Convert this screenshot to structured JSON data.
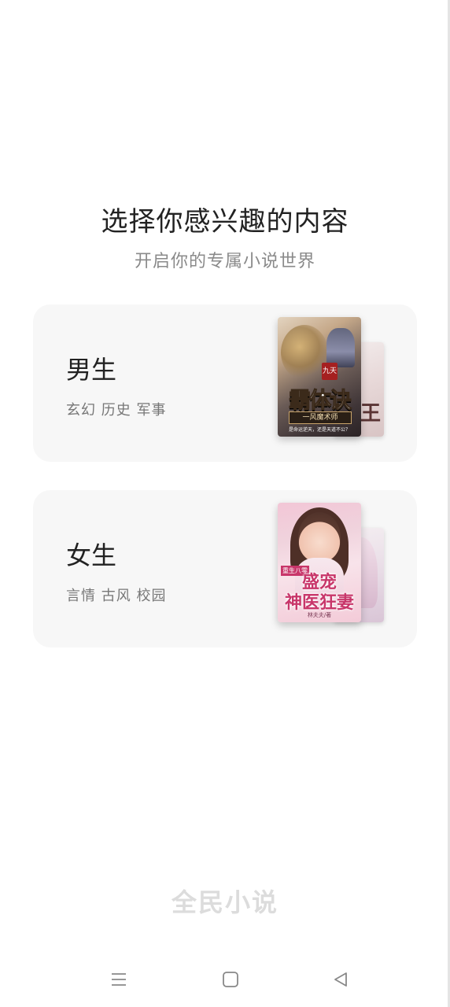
{
  "heading": "选择你感兴趣的内容",
  "subheading": "开启你的专属小说世界",
  "categories": [
    {
      "title": "男生",
      "tags": "玄幻 历史 军事",
      "cover_front": {
        "title": "霸体诀",
        "tag": "九天",
        "badge": "一风魔术师",
        "blurb": "是命运逆天，还是天道不公？"
      },
      "cover_back": {
        "title_fragment": "王"
      }
    },
    {
      "title": "女生",
      "tags": "言情 古风 校园",
      "cover_front": {
        "pretitle": "重生八零",
        "title_line1": "盛宠",
        "title_line2": "神医狂妻",
        "author": "林夫夫/著"
      }
    }
  ],
  "brand": "全民小说",
  "colors": {
    "card_bg": "#f7f7f7",
    "heading": "#222222",
    "subheading": "#8a8a8a",
    "tags": "#777777",
    "brand": "#dcdcdc",
    "nav_icons": "#888888"
  },
  "icons": {
    "menu": "menu-icon",
    "home": "home-icon",
    "back": "back-icon"
  }
}
